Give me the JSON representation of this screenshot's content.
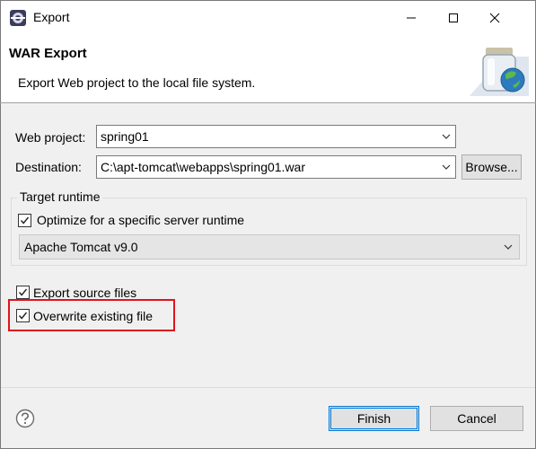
{
  "window": {
    "title": "Export"
  },
  "banner": {
    "title": "WAR Export",
    "description": "Export Web project to the local file system."
  },
  "form": {
    "web_project_label": "Web project:",
    "web_project_value": "spring01",
    "destination_label": "Destination:",
    "destination_value": "C:\\apt-tomcat\\webapps\\spring01.war",
    "browse_label": "Browse..."
  },
  "target_runtime": {
    "legend": "Target runtime",
    "optimize_label": "Optimize for a specific server runtime",
    "optimize_checked": true,
    "runtime_value": "Apache Tomcat v9.0"
  },
  "options": {
    "export_source_label": "Export source files",
    "export_source_checked": true,
    "overwrite_label": "Overwrite existing file",
    "overwrite_checked": true
  },
  "buttons": {
    "finish": "Finish",
    "cancel": "Cancel"
  },
  "colors": {
    "highlight": "#e0141b",
    "default_button_border": "#0078d7"
  }
}
